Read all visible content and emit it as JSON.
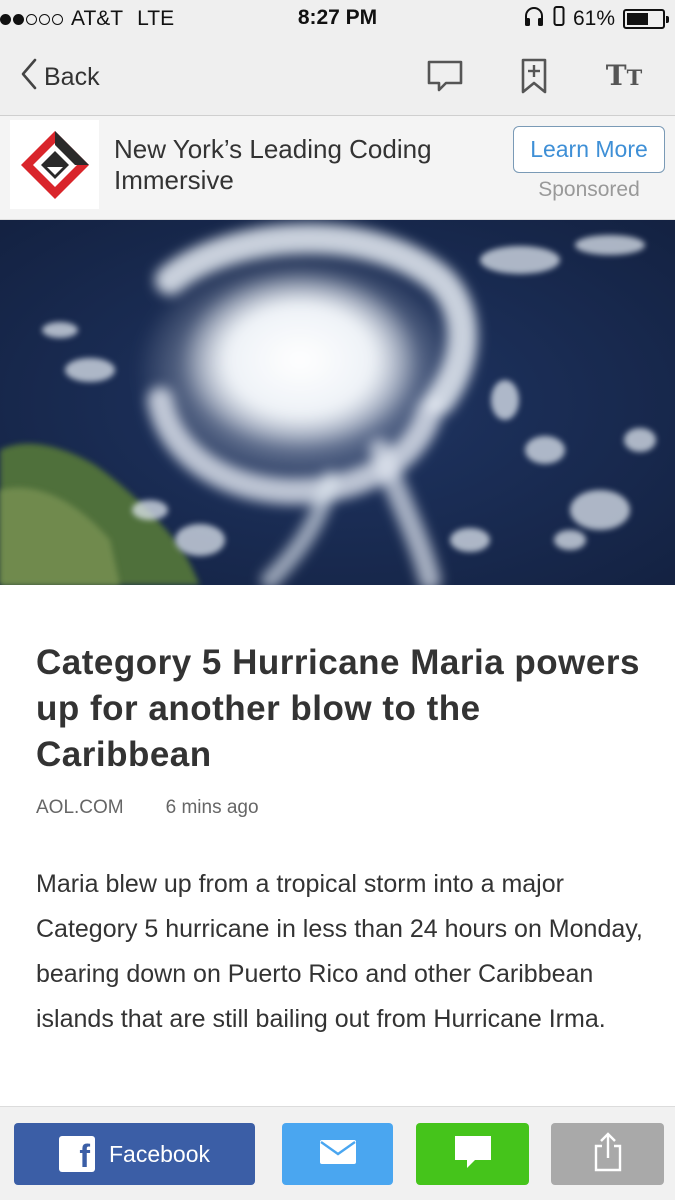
{
  "status_bar": {
    "carrier": "AT&T",
    "network": "LTE",
    "time": "8:27 PM",
    "battery_pct": "61%",
    "battery_level": 0.61,
    "signal_bars_filled": 2,
    "signal_bars_total": 5
  },
  "nav": {
    "back_label": "Back",
    "icons": [
      "comment-icon",
      "bookmark-add-icon",
      "text-size-icon"
    ]
  },
  "ad": {
    "title": "New York’s Leading Coding Immersive",
    "cta_label": "Learn More",
    "sponsored_label": "Sponsored",
    "logo_colors": {
      "red": "#d9252b",
      "dark": "#2a2a2a"
    }
  },
  "article": {
    "headline": "Category 5 Hurricane Maria powers up for another blow to the Caribbean",
    "source": "AOL.COM",
    "time_ago": "6 mins ago",
    "body": "Maria blew up from a tropical storm into a major Category 5 hurricane in less than 24 hours on Monday, bearing down on Puerto Rico and other Caribbean islands that are still bailing out from Hurricane Irma."
  },
  "share": {
    "facebook_label": "Facebook",
    "colors": {
      "facebook": "#3b5ea6",
      "mail": "#4aa6f0",
      "message": "#45c41b",
      "upload": "#a9a9a9"
    }
  },
  "colors": {
    "accent_blue": "#3e8fd6",
    "bar_background": "#efefef"
  }
}
